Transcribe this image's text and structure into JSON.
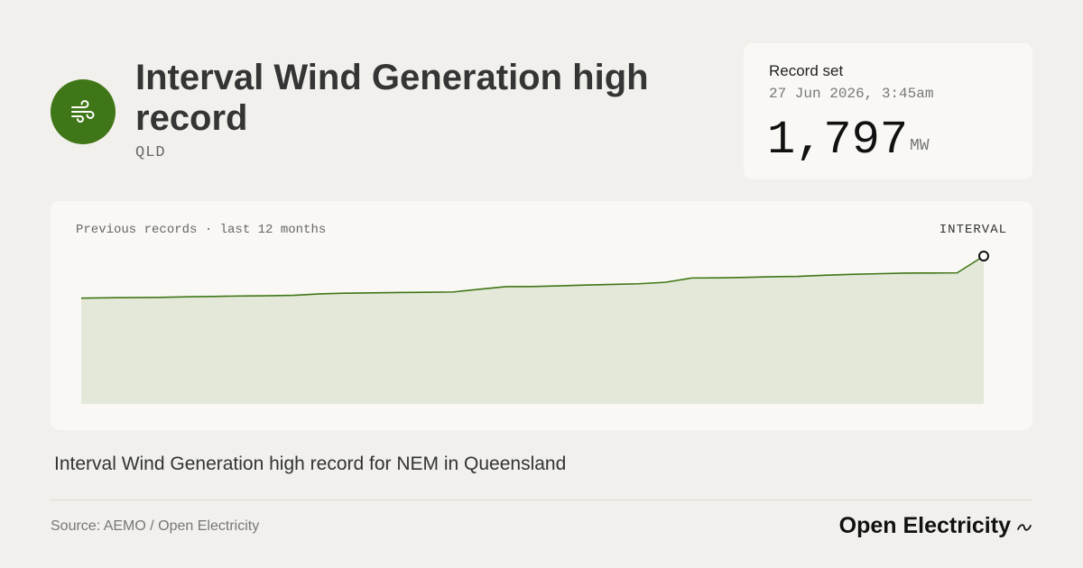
{
  "header": {
    "title": "Interval Wind Generation high record",
    "region": "QLD",
    "icon": "wind-icon",
    "accent_color": "#3f7617"
  },
  "record": {
    "label": "Record set",
    "date": "27 Jun 2026, 3:45am",
    "value": "1,797",
    "unit": "MW"
  },
  "chart": {
    "subtitle": "Previous records · last 12 months",
    "period": "INTERVAL",
    "line_color": "#3f7617",
    "fill_color": "#e4e8d9"
  },
  "chart_data": {
    "type": "area",
    "title": "",
    "xlabel": "",
    "ylabel": "",
    "ylim": [
      0,
      1797
    ],
    "series": [
      {
        "values": [
          1285,
          1290,
          1292,
          1295,
          1302,
          1306,
          1312,
          1314,
          1320,
          1338,
          1346,
          1350,
          1354,
          1357,
          1360,
          1394,
          1425,
          1427,
          1435,
          1444,
          1452,
          1460,
          1478,
          1530,
          1532,
          1537,
          1546,
          1550,
          1563,
          1574,
          1582,
          1590,
          1591,
          1593,
          1797
        ]
      }
    ]
  },
  "description": "Interval Wind Generation high record for NEM in Queensland",
  "footer": {
    "source": "Source: AEMO / Open Electricity",
    "brand": "Open Electricity",
    "brand_icon": "wave-icon"
  }
}
